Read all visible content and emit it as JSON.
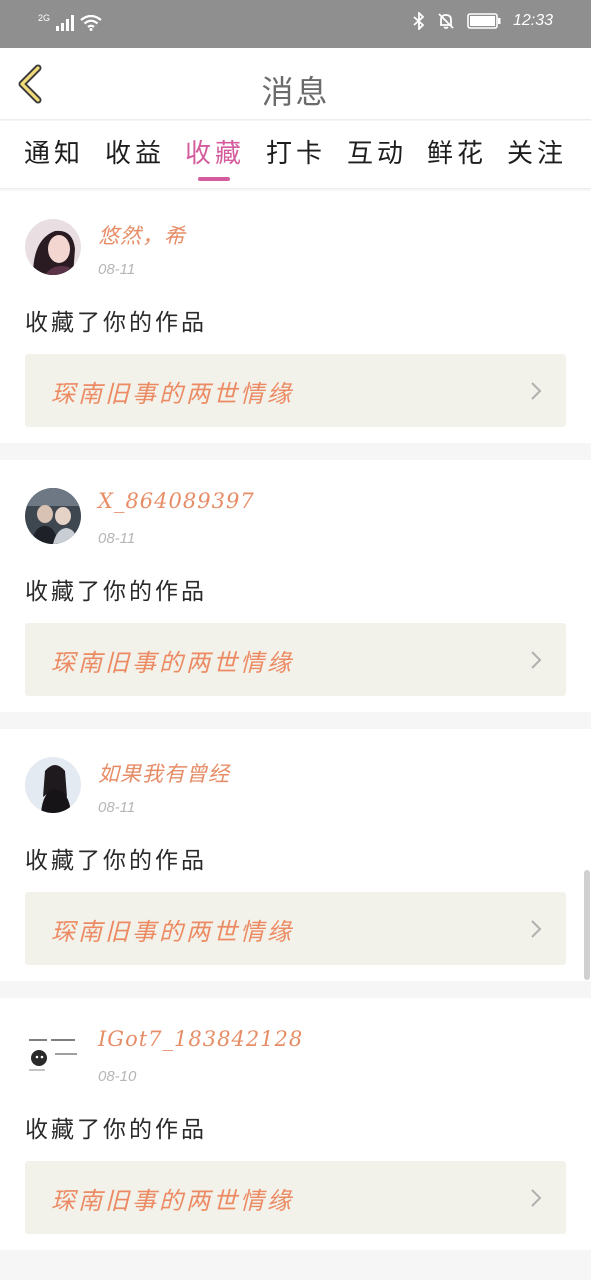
{
  "status_bar": {
    "network": "2G",
    "time": "12:33",
    "icons": [
      "signal-icon",
      "wifi-icon",
      "bluetooth-icon",
      "mute-bell-icon",
      "battery-icon"
    ]
  },
  "header": {
    "title": "消息",
    "back_icon": "chevron-left-icon"
  },
  "tabs": [
    {
      "label": "通知",
      "active": false
    },
    {
      "label": "收益",
      "active": false
    },
    {
      "label": "收藏",
      "active": true
    },
    {
      "label": "打卡",
      "active": false
    },
    {
      "label": "互动",
      "active": false
    },
    {
      "label": "鲜花",
      "active": false
    },
    {
      "label": "关注",
      "active": false
    }
  ],
  "messages": [
    {
      "username": "悠然，希",
      "date": "08-11",
      "action": "收藏了你的作品",
      "work_title": "琛南旧事的两世情缘"
    },
    {
      "username": "X_864089397",
      "date": "08-11",
      "action": "收藏了你的作品",
      "work_title": "琛南旧事的两世情缘"
    },
    {
      "username": "如果我有曾经",
      "date": "08-11",
      "action": "收藏了你的作品",
      "work_title": "琛南旧事的两世情缘"
    },
    {
      "username": "IGot7_183842128",
      "date": "08-10",
      "action": "收藏了你的作品",
      "work_title": "琛南旧事的两世情缘"
    }
  ],
  "colors": {
    "accent": "#d45c9c",
    "username": "#e68d67",
    "work_title": "#ec8a63",
    "work_box": "#f3f2ea",
    "status_bar": "#8f8f8f"
  }
}
